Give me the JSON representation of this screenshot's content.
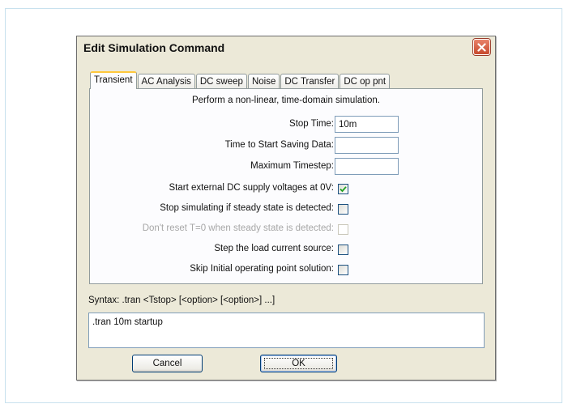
{
  "dialog": {
    "title": "Edit Simulation Command",
    "close_icon": "close-x-icon"
  },
  "tabs": [
    {
      "label": "Transient",
      "active": true
    },
    {
      "label": "AC Analysis",
      "active": false
    },
    {
      "label": "DC sweep",
      "active": false
    },
    {
      "label": "Noise",
      "active": false
    },
    {
      "label": "DC Transfer",
      "active": false
    },
    {
      "label": "DC op pnt",
      "active": false
    }
  ],
  "transient": {
    "description": "Perform a non-linear, time-domain simulation.",
    "stop_time": {
      "label": "Stop Time:",
      "value": "10m"
    },
    "start_saving": {
      "label": "Time to Start Saving Data:",
      "value": ""
    },
    "max_timestep": {
      "label": "Maximum Timestep:",
      "value": ""
    },
    "options": [
      {
        "label": "Start external DC supply voltages at 0V:",
        "checked": true,
        "enabled": true
      },
      {
        "label": "Stop simulating if steady state is detected:",
        "checked": false,
        "enabled": true
      },
      {
        "label": "Don't reset T=0 when steady state is detected:",
        "checked": false,
        "enabled": false
      },
      {
        "label": "Step the load current source:",
        "checked": false,
        "enabled": true
      },
      {
        "label": "Skip Initial operating point solution:",
        "checked": false,
        "enabled": true
      }
    ]
  },
  "syntax": "Syntax:  .tran <Tstop> [<option> [<option>] ...]",
  "command": ".tran 10m startup",
  "buttons": {
    "cancel": "Cancel",
    "ok": "OK"
  },
  "colors": {
    "dialog_bg": "#ece9d8",
    "active_tab_accent": "#ffc83c",
    "close_button": "#c74a2e",
    "checkmark": "#21a121"
  }
}
